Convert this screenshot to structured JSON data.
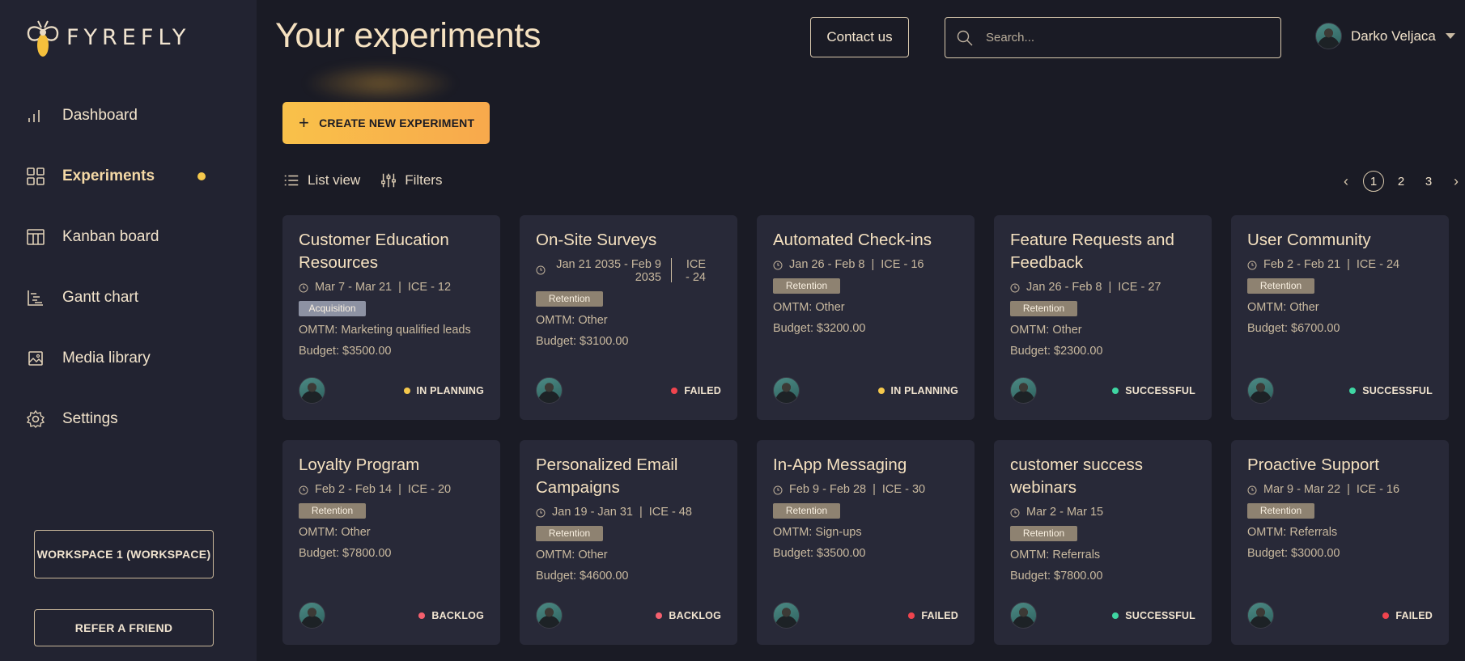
{
  "brand": {
    "name": "FYREFLY"
  },
  "sidebar": {
    "items": [
      {
        "label": "Dashboard",
        "icon": "bar-chart-icon"
      },
      {
        "label": "Experiments",
        "icon": "grid-icon",
        "active": true
      },
      {
        "label": "Kanban board",
        "icon": "kanban-icon"
      },
      {
        "label": "Gantt chart",
        "icon": "gantt-icon"
      },
      {
        "label": "Media library",
        "icon": "image-icon"
      },
      {
        "label": "Settings",
        "icon": "gear-icon"
      }
    ],
    "workspace_label": "WORKSPACE 1 (WORKSPACE)",
    "refer_label": "REFER A FRIEND"
  },
  "header": {
    "title": "Your experiments",
    "contact_label": "Contact us",
    "search_placeholder": "Search...",
    "user_name": "Darko Veljaca"
  },
  "toolbar": {
    "create_label": "CREATE NEW EXPERIMENT",
    "list_view_label": "List view",
    "filters_label": "Filters"
  },
  "pagination": {
    "pages": [
      "1",
      "2",
      "3"
    ],
    "current": "1"
  },
  "colors": {
    "accent": "#f9b84a",
    "status_planning": "#f5c84c",
    "status_failed": "#f0444e",
    "status_success": "#3fd6a3",
    "status_backlog": "#f5606e"
  },
  "cards": [
    {
      "title": "Customer Education Resources",
      "dates": "Mar 7 - Mar 21",
      "ice": "ICE - 12",
      "tag": "Acquisition",
      "omtm": "OMTM: Marketing qualified leads",
      "budget": "Budget: $3500.00",
      "status": "IN PLANNING"
    },
    {
      "title": "On-Site Surveys",
      "dates": "Jan 21 2035 - Feb 9 2035",
      "ice": "ICE - 24",
      "tag": "Retention",
      "omtm": "OMTM: Other",
      "budget": "Budget: $3100.00",
      "status": "FAILED"
    },
    {
      "title": "Automated Check-ins",
      "dates": "Jan 26 - Feb 8",
      "ice": "ICE - 16",
      "tag": "Retention",
      "omtm": "OMTM: Other",
      "budget": "Budget: $3200.00",
      "status": "IN PLANNING"
    },
    {
      "title": "Feature Requests and Feedback",
      "dates": "Jan 26 - Feb 8",
      "ice": "ICE - 27",
      "tag": "Retention",
      "omtm": "OMTM: Other",
      "budget": "Budget: $2300.00",
      "status": "SUCCESSFUL"
    },
    {
      "title": "User Community",
      "dates": "Feb 2 - Feb 21",
      "ice": "ICE - 24",
      "tag": "Retention",
      "omtm": "OMTM: Other",
      "budget": "Budget: $6700.00",
      "status": "SUCCESSFUL"
    },
    {
      "title": "Loyalty Program",
      "dates": "Feb 2 - Feb 14",
      "ice": "ICE - 20",
      "tag": "Retention",
      "omtm": "OMTM: Other",
      "budget": "Budget: $7800.00",
      "status": "BACKLOG"
    },
    {
      "title": "Personalized Email Campaigns",
      "dates": "Jan 19 - Jan 31",
      "ice": "ICE - 48",
      "tag": "Retention",
      "omtm": "OMTM: Other",
      "budget": "Budget: $4600.00",
      "status": "BACKLOG"
    },
    {
      "title": "In-App Messaging",
      "dates": "Feb 9 - Feb 28",
      "ice": "ICE - 30",
      "tag": "Retention",
      "omtm": "OMTM: Sign-ups",
      "budget": "Budget: $3500.00",
      "status": "FAILED"
    },
    {
      "title": "customer success webinars",
      "dates": "Mar 2 - Mar 15",
      "ice": "",
      "tag": "Retention",
      "omtm": "OMTM: Referrals",
      "budget": "Budget: $7800.00",
      "status": "SUCCESSFUL"
    },
    {
      "title": "Proactive Support",
      "dates": "Mar 9 - Mar 22",
      "ice": "ICE - 16",
      "tag": "Retention",
      "omtm": "OMTM: Referrals",
      "budget": "Budget: $3000.00",
      "status": "FAILED"
    }
  ]
}
